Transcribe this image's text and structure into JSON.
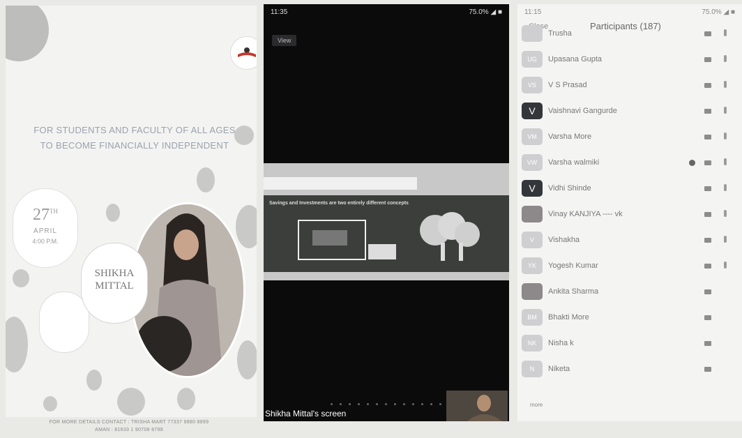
{
  "poster": {
    "tagline_line1": "FOR STUDENTS AND FACULTY OF ALL AGES",
    "tagline_line2": "TO BECOME FINANCIALLY INDEPENDENT",
    "date_day": "27",
    "date_sup": "TH",
    "date_month": "APRIL",
    "date_time": "4:00 P.M.",
    "speaker_first": "SHIKHA",
    "speaker_last": "MITTAL",
    "footer_line1": "FOR MORE DETAILS CONTACT : TRISHA MART 77337 9880 8899",
    "footer_line2": "AMAN : 81633 1 90708 8798"
  },
  "meeting": {
    "status_time": "11:35",
    "status_right": "75.0% ◢ ■",
    "view_button": "View",
    "slide_text": "Savings and Investments are two entirely different concepts",
    "screen_label": "Shikha Mittal's screen"
  },
  "participants": {
    "status_time": "11:15",
    "status_right": "75.0% ◢ ■",
    "close_label": "Close",
    "title": "Participants (187)",
    "more_label": "more",
    "items": [
      {
        "name": "Trusha",
        "avatar": "",
        "style": "light"
      },
      {
        "name": "Upasana Gupta",
        "avatar": "UG",
        "style": "light"
      },
      {
        "name": "V S Prasad",
        "avatar": "VS",
        "style": "light"
      },
      {
        "name": "Vaishnavi Gangurde",
        "avatar": "V",
        "style": "dark"
      },
      {
        "name": "Varsha More",
        "avatar": "VM",
        "style": "light"
      },
      {
        "name": "Varsha walmiki",
        "avatar": "VW",
        "style": "light"
      },
      {
        "name": "Vidhi Shinde",
        "avatar": "V",
        "style": "dark"
      },
      {
        "name": "Vinay KANJIYA ---- vk",
        "avatar": "",
        "style": "photo"
      },
      {
        "name": "Vishakha",
        "avatar": "V",
        "style": "light"
      },
      {
        "name": "Yogesh Kumar",
        "avatar": "YK",
        "style": "light"
      },
      {
        "name": "Ankita Sharma",
        "avatar": "",
        "style": "photo"
      },
      {
        "name": "Bhakti More",
        "avatar": "BM",
        "style": "light"
      },
      {
        "name": "Nisha k",
        "avatar": "NK",
        "style": "light"
      },
      {
        "name": "Niketa",
        "avatar": "N",
        "style": "light"
      }
    ]
  },
  "colors": {
    "meeting_bg": "#0b0b0c",
    "panel_bg": "#f4f4f3",
    "poster_bg": "#f3f3f1"
  }
}
